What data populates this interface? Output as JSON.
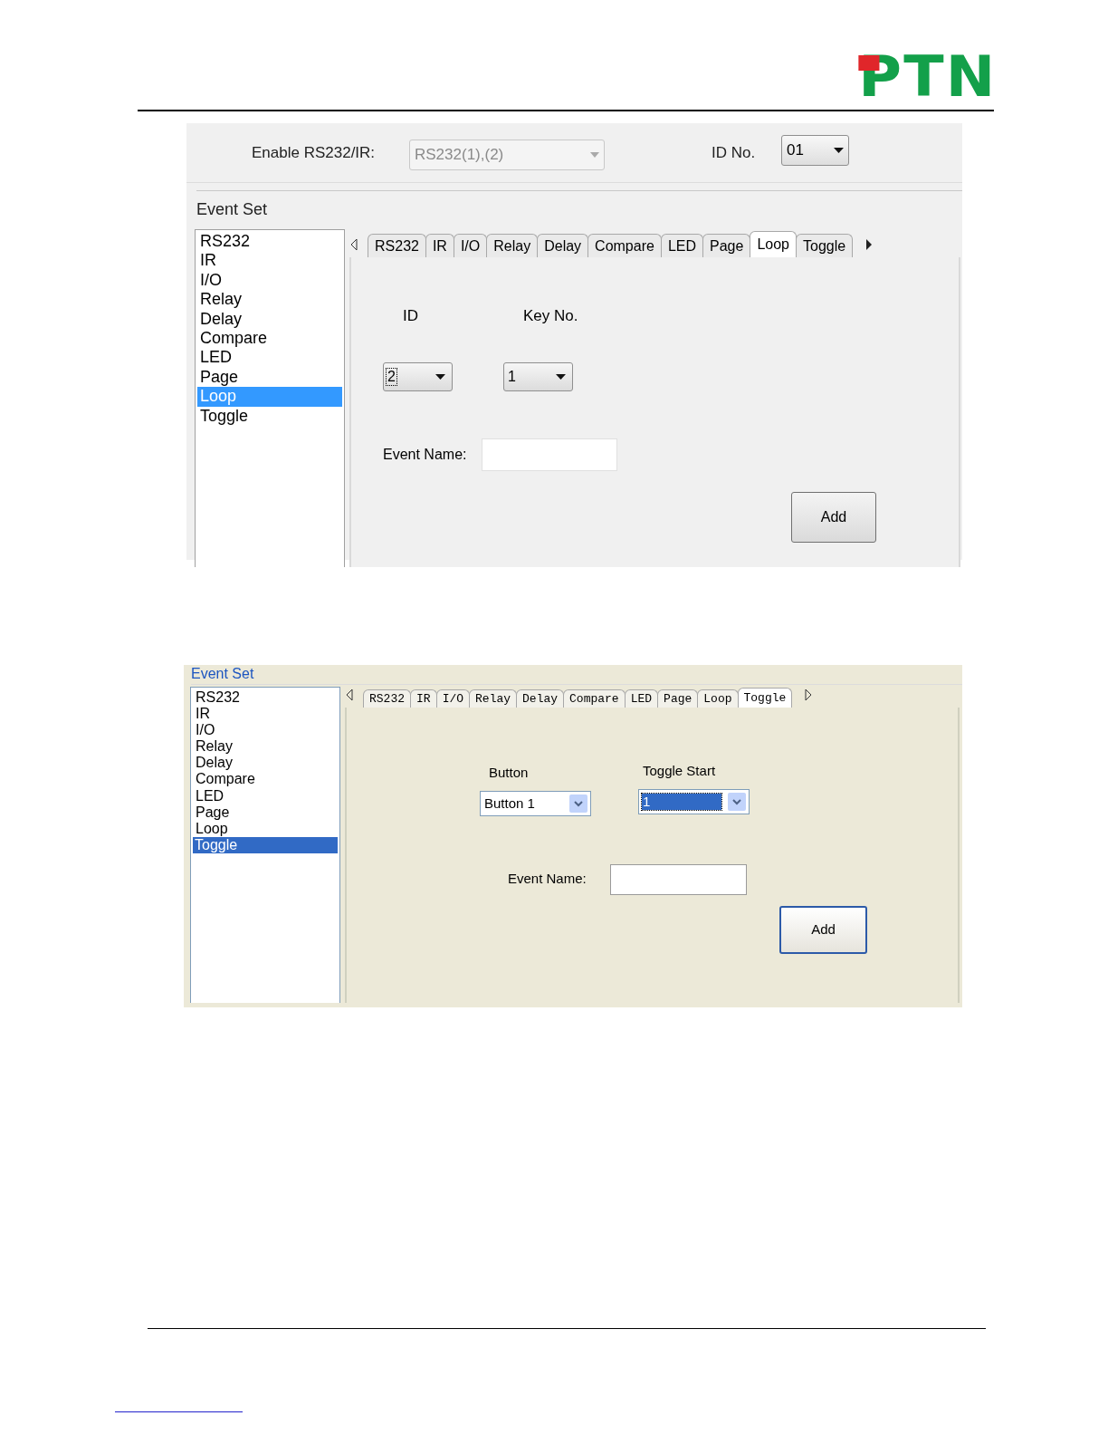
{
  "logo": {
    "text": "PTN"
  },
  "screens": [
    {
      "kind": "win7",
      "header": {
        "enable_label": "Enable RS232/IR:",
        "enable_value": "RS232(1),(2)",
        "enable_disabled": true,
        "id_label": "ID No.",
        "id_value": "01"
      },
      "group_title": "Event Set",
      "list": [
        {
          "label": "RS232",
          "selected": false
        },
        {
          "label": "IR",
          "selected": false
        },
        {
          "label": "I/O",
          "selected": false
        },
        {
          "label": "Relay",
          "selected": false
        },
        {
          "label": "Delay",
          "selected": false
        },
        {
          "label": "Compare",
          "selected": false
        },
        {
          "label": "LED",
          "selected": false
        },
        {
          "label": "Page",
          "selected": false
        },
        {
          "label": "Loop",
          "selected": true
        },
        {
          "label": "Toggle",
          "selected": false
        }
      ],
      "tabs": [
        {
          "label": "RS232",
          "selected": false
        },
        {
          "label": "IR",
          "selected": false
        },
        {
          "label": "I/O",
          "selected": false
        },
        {
          "label": "Relay",
          "selected": false
        },
        {
          "label": "Delay",
          "selected": false
        },
        {
          "label": "Compare",
          "selected": false
        },
        {
          "label": "LED",
          "selected": false
        },
        {
          "label": "Page",
          "selected": false
        },
        {
          "label": "Loop",
          "selected": true
        },
        {
          "label": "Toggle",
          "selected": false
        }
      ],
      "dropdowns": [
        {
          "label": "ID",
          "value": "2",
          "focused": true
        },
        {
          "label": "Key No.",
          "value": "1",
          "focused": false
        }
      ],
      "event_name_label": "Event Name:",
      "add_button": "Add"
    },
    {
      "kind": "xp",
      "group_title": "Event Set",
      "list": [
        {
          "label": "RS232",
          "selected": false
        },
        {
          "label": "IR",
          "selected": false
        },
        {
          "label": "I/O",
          "selected": false
        },
        {
          "label": "Relay",
          "selected": false
        },
        {
          "label": "Delay",
          "selected": false
        },
        {
          "label": "Compare",
          "selected": false
        },
        {
          "label": "LED",
          "selected": false
        },
        {
          "label": "Page",
          "selected": false
        },
        {
          "label": "Loop",
          "selected": false
        },
        {
          "label": "Toggle",
          "selected": true
        }
      ],
      "tabs": [
        {
          "label": "RS232",
          "selected": false
        },
        {
          "label": "IR",
          "selected": false
        },
        {
          "label": "I/O",
          "selected": false
        },
        {
          "label": "Relay",
          "selected": false
        },
        {
          "label": "Delay",
          "selected": false
        },
        {
          "label": "Compare",
          "selected": false
        },
        {
          "label": "LED",
          "selected": false
        },
        {
          "label": "Page",
          "selected": false
        },
        {
          "label": "Loop",
          "selected": false
        },
        {
          "label": "Toggle",
          "selected": true
        }
      ],
      "dropdowns": [
        {
          "label": "Button",
          "value": "Button 1",
          "focused": false
        },
        {
          "label": "Toggle Start",
          "value": "1",
          "focused": true
        }
      ],
      "event_name_label": "Event Name:",
      "add_button": "Add"
    }
  ]
}
